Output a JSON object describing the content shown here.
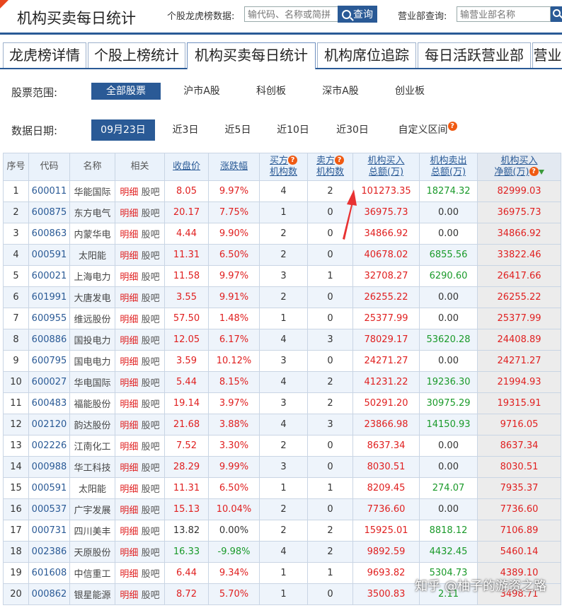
{
  "header": {
    "title": "机构买卖每日统计",
    "stock_search_label": "个股龙虎榜数据:",
    "stock_search_placeholder": "输代码、名称或简拼",
    "search_button": "查询",
    "branch_search_label": "营业部查询:",
    "branch_search_placeholder": "输营业部名称"
  },
  "tabs": [
    {
      "label": "龙虎榜详情"
    },
    {
      "label": "个股上榜统计"
    },
    {
      "label": "机构买卖每日统计"
    },
    {
      "label": "机构席位追踪"
    },
    {
      "label": "每日活跃营业部"
    },
    {
      "label": "营业"
    }
  ],
  "scope": {
    "label": "股票范围:",
    "options": [
      "全部股票",
      "沪市A股",
      "科创板",
      "深市A股",
      "创业板"
    ]
  },
  "date": {
    "label": "数据日期:",
    "options": [
      "09月23日",
      "近3日",
      "近5日",
      "近10日",
      "近30日",
      "自定义区间"
    ]
  },
  "table": {
    "headers": {
      "seq": "序号",
      "code": "代码",
      "name": "名称",
      "related": "相关",
      "close": "收盘价",
      "change": "涨跌幅",
      "buyers_1": "买方",
      "buyers_2": "机构数",
      "sellers_1": "卖方",
      "sellers_2": "机构数",
      "buy_total_1": "机构买入",
      "buy_total_2": "总额(万)",
      "sell_total_1": "机构卖出",
      "sell_total_2": "总额(万)",
      "net_1": "机构买入",
      "net_2": "净额(万)"
    },
    "detail_link": "明细",
    "forum_link": "股吧",
    "rows": [
      {
        "seq": "1",
        "code": "600011",
        "name": "华能国际",
        "close": "8.05",
        "change": "9.97%",
        "buyers": "4",
        "sellers": "2",
        "buy": "101273.35",
        "sell": "18274.32",
        "net": "82999.03",
        "dir": "up"
      },
      {
        "seq": "2",
        "code": "600875",
        "name": "东方电气",
        "close": "20.17",
        "change": "7.75%",
        "buyers": "1",
        "sellers": "0",
        "buy": "36975.73",
        "sell": "0.00",
        "net": "36975.73",
        "dir": "up"
      },
      {
        "seq": "3",
        "code": "600863",
        "name": "内蒙华电",
        "close": "4.44",
        "change": "9.90%",
        "buyers": "2",
        "sellers": "0",
        "buy": "34866.92",
        "sell": "0.00",
        "net": "34866.92",
        "dir": "up"
      },
      {
        "seq": "4",
        "code": "000591",
        "name": "太阳能",
        "close": "11.31",
        "change": "6.50%",
        "buyers": "2",
        "sellers": "0",
        "buy": "40678.02",
        "sell": "6855.56",
        "net": "33822.46",
        "dir": "up"
      },
      {
        "seq": "5",
        "code": "600021",
        "name": "上海电力",
        "close": "11.58",
        "change": "9.97%",
        "buyers": "3",
        "sellers": "1",
        "buy": "32708.27",
        "sell": "6290.60",
        "net": "26417.66",
        "dir": "up"
      },
      {
        "seq": "6",
        "code": "601991",
        "name": "大唐发电",
        "close": "3.55",
        "change": "9.91%",
        "buyers": "2",
        "sellers": "0",
        "buy": "26255.22",
        "sell": "0.00",
        "net": "26255.22",
        "dir": "up"
      },
      {
        "seq": "7",
        "code": "600955",
        "name": "维远股份",
        "close": "57.50",
        "change": "1.48%",
        "buyers": "1",
        "sellers": "0",
        "buy": "25377.99",
        "sell": "0.00",
        "net": "25377.99",
        "dir": "up"
      },
      {
        "seq": "8",
        "code": "600886",
        "name": "国投电力",
        "close": "12.05",
        "change": "6.17%",
        "buyers": "4",
        "sellers": "3",
        "buy": "78029.17",
        "sell": "53620.28",
        "net": "24408.89",
        "dir": "up"
      },
      {
        "seq": "9",
        "code": "600795",
        "name": "国电电力",
        "close": "3.59",
        "change": "10.12%",
        "buyers": "3",
        "sellers": "0",
        "buy": "24271.27",
        "sell": "0.00",
        "net": "24271.27",
        "dir": "up"
      },
      {
        "seq": "10",
        "code": "600027",
        "name": "华电国际",
        "close": "5.44",
        "change": "8.15%",
        "buyers": "4",
        "sellers": "2",
        "buy": "41231.22",
        "sell": "19236.30",
        "net": "21994.93",
        "dir": "up"
      },
      {
        "seq": "11",
        "code": "600483",
        "name": "福能股份",
        "close": "19.14",
        "change": "3.97%",
        "buyers": "3",
        "sellers": "2",
        "buy": "50291.20",
        "sell": "30975.29",
        "net": "19315.91",
        "dir": "up"
      },
      {
        "seq": "12",
        "code": "002120",
        "name": "韵达股份",
        "close": "21.68",
        "change": "3.88%",
        "buyers": "4",
        "sellers": "3",
        "buy": "23866.98",
        "sell": "14150.93",
        "net": "9716.05",
        "dir": "up"
      },
      {
        "seq": "13",
        "code": "002226",
        "name": "江南化工",
        "close": "7.52",
        "change": "3.30%",
        "buyers": "2",
        "sellers": "0",
        "buy": "8637.34",
        "sell": "0.00",
        "net": "8637.34",
        "dir": "up"
      },
      {
        "seq": "14",
        "code": "000988",
        "name": "华工科技",
        "close": "28.29",
        "change": "9.99%",
        "buyers": "3",
        "sellers": "0",
        "buy": "8030.51",
        "sell": "0.00",
        "net": "8030.51",
        "dir": "up"
      },
      {
        "seq": "15",
        "code": "000591",
        "name": "太阳能",
        "close": "11.31",
        "change": "6.50%",
        "buyers": "1",
        "sellers": "1",
        "buy": "8209.45",
        "sell": "274.07",
        "net": "7935.37",
        "dir": "up"
      },
      {
        "seq": "16",
        "code": "000537",
        "name": "广宇发展",
        "close": "15.13",
        "change": "10.04%",
        "buyers": "2",
        "sellers": "0",
        "buy": "7736.60",
        "sell": "0.00",
        "net": "7736.60",
        "dir": "up"
      },
      {
        "seq": "17",
        "code": "000731",
        "name": "四川美丰",
        "close": "13.82",
        "change": "0.00%",
        "buyers": "2",
        "sellers": "2",
        "buy": "15925.01",
        "sell": "8818.12",
        "net": "7106.89",
        "dir": "flat"
      },
      {
        "seq": "18",
        "code": "002386",
        "name": "天原股份",
        "close": "16.33",
        "change": "-9.98%",
        "buyers": "4",
        "sellers": "2",
        "buy": "9892.59",
        "sell": "4432.45",
        "net": "5460.14",
        "dir": "down"
      },
      {
        "seq": "19",
        "code": "601608",
        "name": "中信重工",
        "close": "6.44",
        "change": "9.34%",
        "buyers": "1",
        "sellers": "1",
        "buy": "9693.82",
        "sell": "5304.73",
        "net": "4389.10",
        "dir": "up"
      },
      {
        "seq": "20",
        "code": "000862",
        "name": "银星能源",
        "close": "8.72",
        "change": "5.70%",
        "buyers": "1",
        "sellers": "0",
        "buy": "3500.83",
        "sell": "2.11",
        "net": "3498.71",
        "dir": "up"
      }
    ]
  },
  "watermark": "知乎 @柚子的游资之路",
  "icons": {
    "search": "magnifier-icon",
    "help": "question-icon",
    "sort": "sort-down-icon",
    "annotation": "red-arrow-annotation"
  },
  "colors": {
    "brand": "#2a5a96",
    "up": "#e02020",
    "down": "#1a9a2a",
    "help": "#f05a12",
    "annotation": "#e83232"
  }
}
